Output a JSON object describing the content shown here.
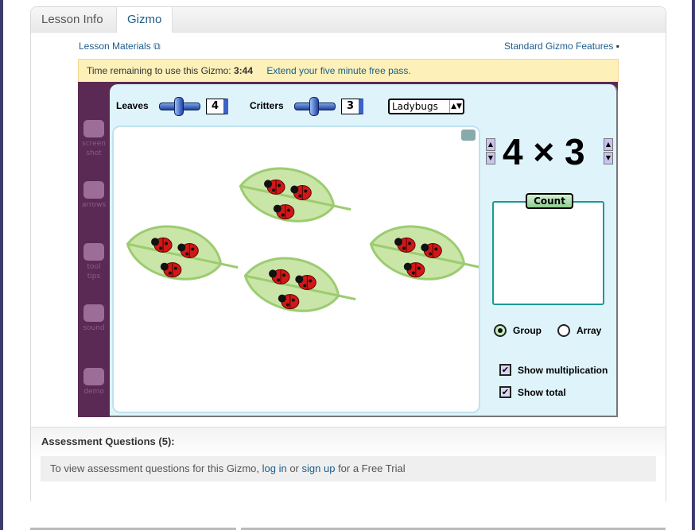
{
  "tabs": [
    {
      "label": "Lesson Info"
    },
    {
      "label": "Gizmo",
      "active": true
    }
  ],
  "links": {
    "lesson_materials": "Lesson Materials",
    "standard_features": "Standard Gizmo Features"
  },
  "timer": {
    "label": "Time remaining to use this Gizmo:",
    "value": "3:44",
    "extend": "Extend your five minute free pass."
  },
  "toolbar": [
    {
      "label": "screen shot",
      "icon": "camera-icon"
    },
    {
      "label": "arrows",
      "icon": "arrows-icon"
    },
    {
      "label": "tool tips",
      "icon": "tooltip-icon"
    },
    {
      "label": "sound",
      "icon": "speaker-icon"
    },
    {
      "label": "demo",
      "icon": "tv-icon"
    }
  ],
  "controls": {
    "leaves_label": "Leaves",
    "leaves_value": "4",
    "critters_label": "Critters",
    "critters_value": "3",
    "critter_type": "Ladybugs"
  },
  "expression": {
    "left": "4",
    "op": "×",
    "right": "3"
  },
  "count_label": "Count",
  "mode": {
    "group": "Group",
    "array": "Array",
    "selected": "Group"
  },
  "checks": {
    "show_multiplication": "Show multiplication",
    "show_total": "Show total",
    "multiplication_checked": true,
    "total_checked": true
  },
  "assessment": {
    "title": "Assessment Questions (5):",
    "text_a": "To view assessment questions for this Gizmo,",
    "login": "log in",
    "or": "or",
    "signup": "sign up",
    "text_b": "for a Free Trial"
  },
  "colors": {
    "purple": "#5a2a55",
    "panel": "#dff3fb",
    "link": "#1c5d8a",
    "leaf": "#c9e6a8",
    "ladybug": "#d01818"
  }
}
